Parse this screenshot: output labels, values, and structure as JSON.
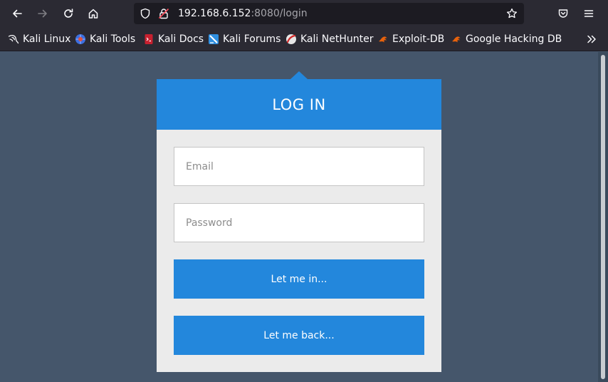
{
  "browser": {
    "url": {
      "host": "192.168.6.152",
      "rest": ":8080/login"
    },
    "bookmarks": [
      {
        "label": "Kali Linux",
        "icon": "kali-dragon-icon"
      },
      {
        "label": "Kali Tools",
        "icon": "kali-tools-icon"
      },
      {
        "label": "Kali Docs",
        "icon": "kali-docs-icon"
      },
      {
        "label": "Kali Forums",
        "icon": "kali-forums-icon"
      },
      {
        "label": "Kali NetHunter",
        "icon": "kali-nethunter-icon"
      },
      {
        "label": "Exploit-DB",
        "icon": "exploit-db-icon"
      },
      {
        "label": "Google Hacking DB",
        "icon": "ghdb-icon"
      }
    ]
  },
  "login": {
    "title": "LOG IN",
    "email_placeholder": "Email",
    "password_placeholder": "Password",
    "submit_label": "Let me in...",
    "back_label": "Let me back..."
  },
  "colors": {
    "page_bg": "#45566b",
    "accent": "#2387dc",
    "card_bg": "#ebebeb",
    "chrome_bg": "#2b2a33"
  }
}
